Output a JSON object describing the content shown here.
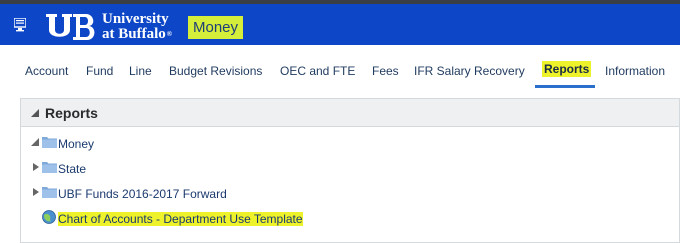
{
  "header": {
    "brand_line1": "University",
    "brand_line2": "at Buffalo",
    "brand_mark": "registered",
    "app_name": "Money",
    "accent_color": "#0d47c8",
    "highlight_color": "#eef22a",
    "icons": [
      "menu-icon",
      "ub-logo-icon"
    ]
  },
  "nav": {
    "tabs": [
      {
        "label": "Account"
      },
      {
        "label": "Fund"
      },
      {
        "label": "Line"
      },
      {
        "label": "Budget Revisions"
      },
      {
        "label": "OEC and FTE"
      },
      {
        "label": "Fees"
      },
      {
        "label": "IFR Salary Recovery"
      },
      {
        "label": "Reports",
        "active": true
      },
      {
        "label": "Information"
      }
    ]
  },
  "panel": {
    "title": "Reports",
    "tree": [
      {
        "label": "Money",
        "state": "expanded",
        "icon": "folder-icon"
      },
      {
        "label": "State",
        "state": "collapsed",
        "icon": "folder-icon"
      },
      {
        "label": "UBF Funds 2016-2017 Forward",
        "state": "collapsed",
        "icon": "folder-icon"
      },
      {
        "label": "Chart of Accounts - Department Use Template",
        "state": "leaf",
        "icon": "report-globe-icon",
        "highlighted": true
      }
    ]
  }
}
